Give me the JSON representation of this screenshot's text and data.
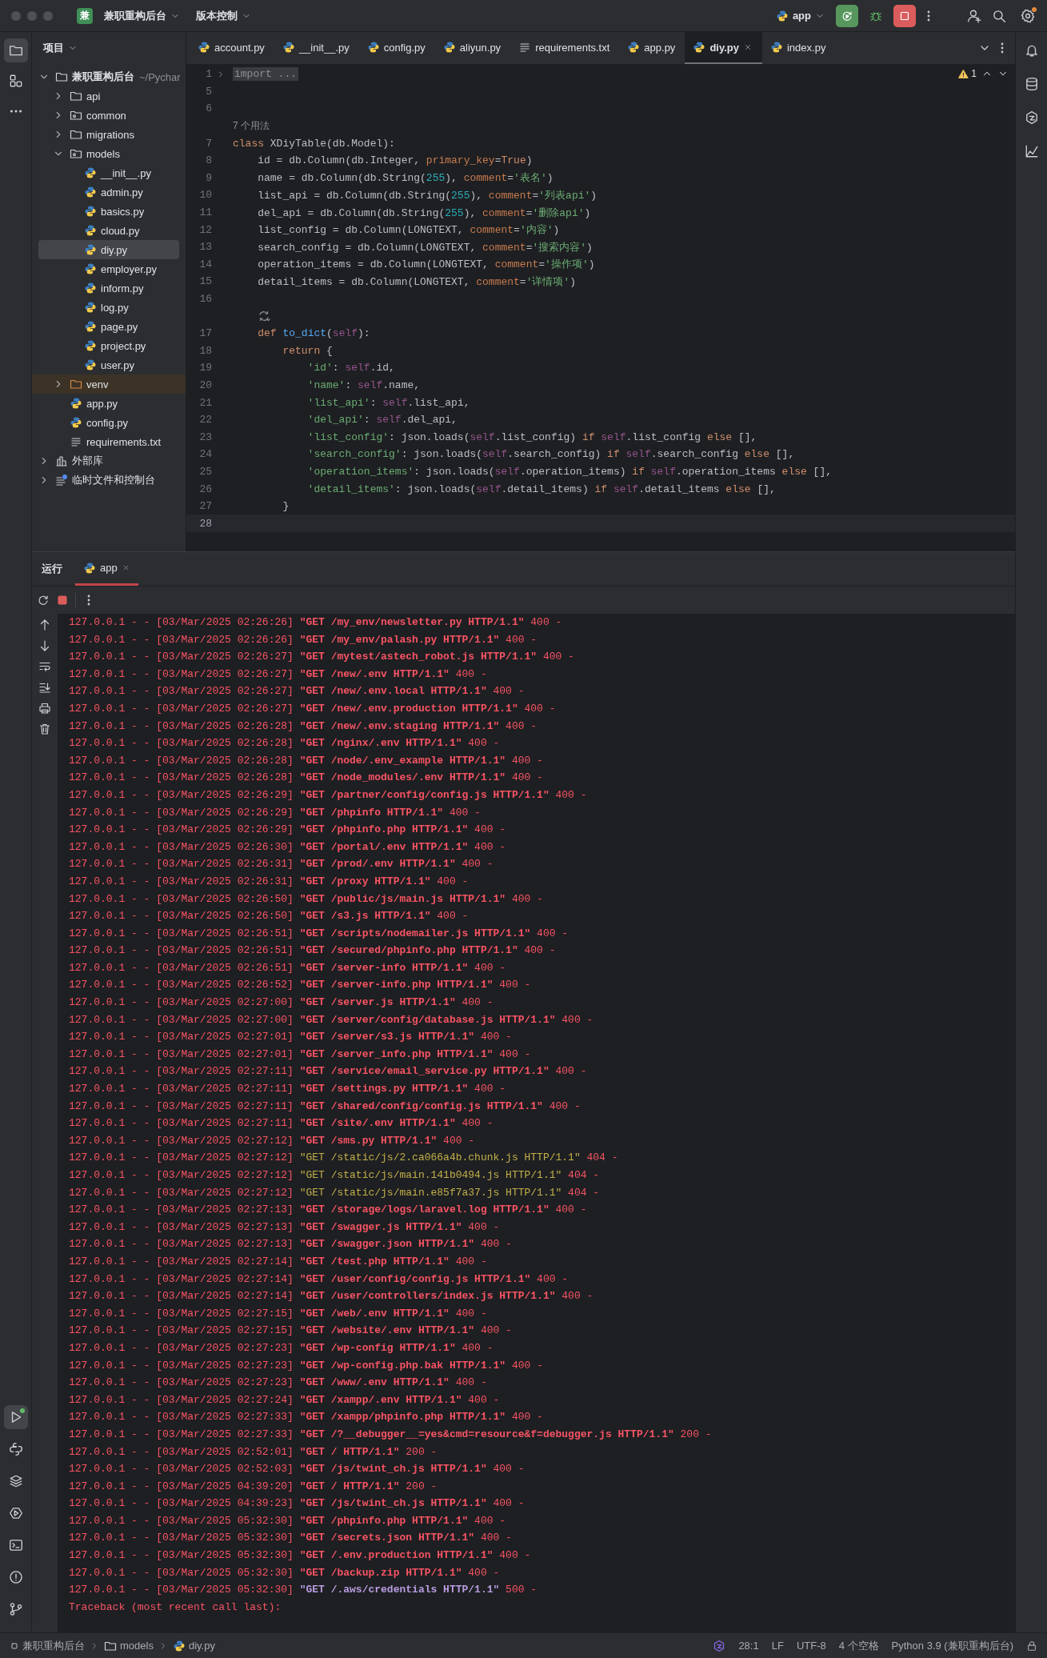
{
  "titlebar": {
    "project_badge": "兼",
    "project": "兼职重构后台",
    "vcs": "版本控制",
    "run_config": "app"
  },
  "project": {
    "title": "项目",
    "tree": [
      {
        "kind": "root",
        "label": "兼职重构后台",
        "path": "~/Pychar",
        "expanded": true,
        "selected": false,
        "children": [
          {
            "kind": "folder",
            "label": "api",
            "expanded": false,
            "selected": false
          },
          {
            "kind": "package",
            "label": "common",
            "expanded": false,
            "selected": false
          },
          {
            "kind": "folder",
            "label": "migrations",
            "expanded": false,
            "selected": false
          },
          {
            "kind": "package",
            "label": "models",
            "expanded": true,
            "selected": false,
            "children": [
              {
                "kind": "python",
                "label": "__init__.py",
                "selected": false
              },
              {
                "kind": "python",
                "label": "admin.py",
                "selected": false
              },
              {
                "kind": "python",
                "label": "basics.py",
                "selected": false
              },
              {
                "kind": "python",
                "label": "cloud.py",
                "selected": false
              },
              {
                "kind": "python",
                "label": "diy.py",
                "selected": true
              },
              {
                "kind": "python",
                "label": "employer.py",
                "selected": false
              },
              {
                "kind": "python",
                "label": "inform.py",
                "selected": false
              },
              {
                "kind": "python",
                "label": "log.py",
                "selected": false
              },
              {
                "kind": "python",
                "label": "page.py",
                "selected": false
              },
              {
                "kind": "python",
                "label": "project.py",
                "selected": false
              },
              {
                "kind": "python",
                "label": "user.py",
                "selected": false
              }
            ]
          },
          {
            "kind": "excluded",
            "label": "venv",
            "expanded": false,
            "selected": false
          },
          {
            "kind": "python",
            "label": "app.py",
            "selected": false
          },
          {
            "kind": "python",
            "label": "config.py",
            "selected": false
          },
          {
            "kind": "text",
            "label": "requirements.txt",
            "selected": false
          }
        ]
      },
      {
        "kind": "library",
        "label": "外部库",
        "expanded": false,
        "selected": false
      },
      {
        "kind": "scratch",
        "label": "临时文件和控制台",
        "expanded": false,
        "selected": false
      }
    ]
  },
  "editor": {
    "tabs": [
      {
        "kind": "python",
        "label": "account.py",
        "selected": false
      },
      {
        "kind": "python",
        "label": "__init__.py",
        "selected": false
      },
      {
        "kind": "python",
        "label": "config.py",
        "selected": false
      },
      {
        "kind": "python",
        "label": "aliyun.py",
        "selected": false
      },
      {
        "kind": "text",
        "label": "requirements.txt",
        "selected": false
      },
      {
        "kind": "python",
        "label": "app.py",
        "selected": false
      },
      {
        "kind": "python",
        "label": "diy.py",
        "selected": true
      },
      {
        "kind": "python",
        "label": "index.py",
        "selected": false
      }
    ],
    "warnings": "1",
    "rows": [
      {
        "kind": "folded",
        "number": "1",
        "tokens": [
          {
            "kind": "fold",
            "text": "import ..."
          }
        ]
      },
      {
        "kind": "code",
        "number": "5"
      },
      {
        "kind": "code",
        "number": "6"
      },
      {
        "kind": "hint",
        "text": "7 个用法"
      },
      {
        "kind": "code",
        "number": "7",
        "tokens": [
          {
            "kind": "k",
            "text": "class "
          },
          {
            "kind": "p",
            "text": "XDiyTable(db.Model):"
          }
        ]
      },
      {
        "kind": "code",
        "number": "8",
        "tokens": [
          {
            "kind": "p",
            "text": "    id = db.Column(db.Integer, "
          },
          {
            "kind": "a",
            "text": "primary_key"
          },
          {
            "kind": "p",
            "text": "="
          },
          {
            "kind": "k",
            "text": "True"
          },
          {
            "kind": "p",
            "text": ")"
          }
        ]
      },
      {
        "kind": "code",
        "number": "9",
        "tokens": [
          {
            "kind": "p",
            "text": "    name = db.Column(db.String("
          },
          {
            "kind": "n",
            "text": "255"
          },
          {
            "kind": "p",
            "text": "), "
          },
          {
            "kind": "a",
            "text": "comment"
          },
          {
            "kind": "p",
            "text": "="
          },
          {
            "kind": "s",
            "text": "'表名'"
          },
          {
            "kind": "p",
            "text": ")"
          }
        ]
      },
      {
        "kind": "code",
        "number": "10",
        "tokens": [
          {
            "kind": "p",
            "text": "    list_api = db.Column(db.String("
          },
          {
            "kind": "n",
            "text": "255"
          },
          {
            "kind": "p",
            "text": "), "
          },
          {
            "kind": "a",
            "text": "comment"
          },
          {
            "kind": "p",
            "text": "="
          },
          {
            "kind": "s",
            "text": "'列表api'"
          },
          {
            "kind": "p",
            "text": ")"
          }
        ]
      },
      {
        "kind": "code",
        "number": "11",
        "tokens": [
          {
            "kind": "p",
            "text": "    del_api = db.Column(db.String("
          },
          {
            "kind": "n",
            "text": "255"
          },
          {
            "kind": "p",
            "text": "), "
          },
          {
            "kind": "a",
            "text": "comment"
          },
          {
            "kind": "p",
            "text": "="
          },
          {
            "kind": "s",
            "text": "'删除api'"
          },
          {
            "kind": "p",
            "text": ")"
          }
        ]
      },
      {
        "kind": "code",
        "number": "12",
        "tokens": [
          {
            "kind": "p",
            "text": "    list_config = db.Column(LONGTEXT, "
          },
          {
            "kind": "a",
            "text": "comment"
          },
          {
            "kind": "p",
            "text": "="
          },
          {
            "kind": "s",
            "text": "'内容'"
          },
          {
            "kind": "p",
            "text": ")"
          }
        ]
      },
      {
        "kind": "code",
        "number": "13",
        "tokens": [
          {
            "kind": "p",
            "text": "    search_config = db.Column(LONGTEXT, "
          },
          {
            "kind": "a",
            "text": "comment"
          },
          {
            "kind": "p",
            "text": "="
          },
          {
            "kind": "s",
            "text": "'搜索内容'"
          },
          {
            "kind": "p",
            "text": ")"
          }
        ]
      },
      {
        "kind": "code",
        "number": "14",
        "tokens": [
          {
            "kind": "p",
            "text": "    operation_items = db.Column(LONGTEXT, "
          },
          {
            "kind": "a",
            "text": "comment"
          },
          {
            "kind": "p",
            "text": "="
          },
          {
            "kind": "s",
            "text": "'操作项'"
          },
          {
            "kind": "p",
            "text": ")"
          }
        ]
      },
      {
        "kind": "code",
        "number": "15",
        "tokens": [
          {
            "kind": "p",
            "text": "    detail_items = db.Column(LONGTEXT, "
          },
          {
            "kind": "a",
            "text": "comment"
          },
          {
            "kind": "p",
            "text": "="
          },
          {
            "kind": "s",
            "text": "'详情项'"
          },
          {
            "kind": "p",
            "text": ")"
          }
        ]
      },
      {
        "kind": "code",
        "number": "16"
      },
      {
        "kind": "marker"
      },
      {
        "kind": "code",
        "number": "17",
        "tokens": [
          {
            "kind": "k",
            "text": "    def "
          },
          {
            "kind": "f",
            "text": "to_dict"
          },
          {
            "kind": "p",
            "text": "("
          },
          {
            "kind": "self",
            "text": "self"
          },
          {
            "kind": "p",
            "text": "):"
          }
        ]
      },
      {
        "kind": "code",
        "number": "18",
        "tokens": [
          {
            "kind": "k",
            "text": "        return"
          },
          {
            "kind": "p",
            "text": " {"
          }
        ]
      },
      {
        "kind": "code",
        "number": "19",
        "tokens": [
          {
            "kind": "s",
            "text": "            'id'"
          },
          {
            "kind": "p",
            "text": ": "
          },
          {
            "kind": "self",
            "text": "self"
          },
          {
            "kind": "p",
            "text": ".id,"
          }
        ]
      },
      {
        "kind": "code",
        "number": "20",
        "tokens": [
          {
            "kind": "s",
            "text": "            'name'"
          },
          {
            "kind": "p",
            "text": ": "
          },
          {
            "kind": "self",
            "text": "self"
          },
          {
            "kind": "p",
            "text": ".name,"
          }
        ]
      },
      {
        "kind": "code",
        "number": "21",
        "tokens": [
          {
            "kind": "s",
            "text": "            'list_api'"
          },
          {
            "kind": "p",
            "text": ": "
          },
          {
            "kind": "self",
            "text": "self"
          },
          {
            "kind": "p",
            "text": ".list_api,"
          }
        ]
      },
      {
        "kind": "code",
        "number": "22",
        "tokens": [
          {
            "kind": "s",
            "text": "            'del_api'"
          },
          {
            "kind": "p",
            "text": ": "
          },
          {
            "kind": "self",
            "text": "self"
          },
          {
            "kind": "p",
            "text": ".del_api,"
          }
        ]
      },
      {
        "kind": "code",
        "number": "23",
        "tokens": [
          {
            "kind": "s",
            "text": "            'list_config'"
          },
          {
            "kind": "p",
            "text": ": json.loads("
          },
          {
            "kind": "self",
            "text": "self"
          },
          {
            "kind": "p",
            "text": ".list_config) "
          },
          {
            "kind": "k",
            "text": "if "
          },
          {
            "kind": "self",
            "text": "self"
          },
          {
            "kind": "p",
            "text": ".list_config "
          },
          {
            "kind": "k",
            "text": "else"
          },
          {
            "kind": "p",
            "text": " [],"
          }
        ]
      },
      {
        "kind": "code",
        "number": "24",
        "tokens": [
          {
            "kind": "s",
            "text": "            'search_config'"
          },
          {
            "kind": "p",
            "text": ": json.loads("
          },
          {
            "kind": "self",
            "text": "self"
          },
          {
            "kind": "p",
            "text": ".search_config) "
          },
          {
            "kind": "k",
            "text": "if "
          },
          {
            "kind": "self",
            "text": "self"
          },
          {
            "kind": "p",
            "text": ".search_config "
          },
          {
            "kind": "k",
            "text": "else"
          },
          {
            "kind": "p",
            "text": " [],"
          }
        ]
      },
      {
        "kind": "code",
        "number": "25",
        "tokens": [
          {
            "kind": "s",
            "text": "            'operation_items'"
          },
          {
            "kind": "p",
            "text": ": json.loads("
          },
          {
            "kind": "self",
            "text": "self"
          },
          {
            "kind": "p",
            "text": ".operation_items) "
          },
          {
            "kind": "k",
            "text": "if "
          },
          {
            "kind": "self",
            "text": "self"
          },
          {
            "kind": "p",
            "text": ".operation_items "
          },
          {
            "kind": "k",
            "text": "else"
          },
          {
            "kind": "p",
            "text": " [],"
          }
        ]
      },
      {
        "kind": "code",
        "number": "26",
        "tokens": [
          {
            "kind": "s",
            "text": "            'detail_items'"
          },
          {
            "kind": "p",
            "text": ": json.loads("
          },
          {
            "kind": "self",
            "text": "self"
          },
          {
            "kind": "p",
            "text": ".detail_items) "
          },
          {
            "kind": "k",
            "text": "if "
          },
          {
            "kind": "self",
            "text": "self"
          },
          {
            "kind": "p",
            "text": ".detail_items "
          },
          {
            "kind": "k",
            "text": "else"
          },
          {
            "kind": "p",
            "text": " [],"
          }
        ]
      },
      {
        "kind": "code",
        "number": "27",
        "tokens": [
          {
            "kind": "p",
            "text": "        }"
          }
        ]
      },
      {
        "kind": "current",
        "number": "28"
      }
    ]
  },
  "run": {
    "title": "运行",
    "tabs": [
      {
        "label": "app",
        "selected": true
      }
    ],
    "log": [
      {
        "kind": "error",
        "text": "127.0.0.1 - - [03/Mar/2025 02:26:26] ",
        "request": "\"GET /my_env/newsletter.py HTTP/1.1\"",
        "tail": " 400 -"
      },
      {
        "kind": "error",
        "text": "127.0.0.1 - - [03/Mar/2025 02:26:26] ",
        "request": "\"GET /my_env/palash.py HTTP/1.1\"",
        "tail": " 400 -"
      },
      {
        "kind": "error",
        "text": "127.0.0.1 - - [03/Mar/2025 02:26:27] ",
        "request": "\"GET /mytest/astech_robot.js HTTP/1.1\"",
        "tail": " 400 -"
      },
      {
        "kind": "error",
        "text": "127.0.0.1 - - [03/Mar/2025 02:26:27] ",
        "request": "\"GET /new/.env HTTP/1.1\"",
        "tail": " 400 -"
      },
      {
        "kind": "error",
        "text": "127.0.0.1 - - [03/Mar/2025 02:26:27] ",
        "request": "\"GET /new/.env.local HTTP/1.1\"",
        "tail": " 400 -"
      },
      {
        "kind": "error",
        "text": "127.0.0.1 - - [03/Mar/2025 02:26:27] ",
        "request": "\"GET /new/.env.production HTTP/1.1\"",
        "tail": " 400 -"
      },
      {
        "kind": "error",
        "text": "127.0.0.1 - - [03/Mar/2025 02:26:28] ",
        "request": "\"GET /new/.env.staging HTTP/1.1\"",
        "tail": " 400 -"
      },
      {
        "kind": "error",
        "text": "127.0.0.1 - - [03/Mar/2025 02:26:28] ",
        "request": "\"GET /nginx/.env HTTP/1.1\"",
        "tail": " 400 -"
      },
      {
        "kind": "error",
        "text": "127.0.0.1 - - [03/Mar/2025 02:26:28] ",
        "request": "\"GET /node/.env_example HTTP/1.1\"",
        "tail": " 400 -"
      },
      {
        "kind": "error",
        "text": "127.0.0.1 - - [03/Mar/2025 02:26:28] ",
        "request": "\"GET /node_modules/.env HTTP/1.1\"",
        "tail": " 400 -"
      },
      {
        "kind": "error",
        "text": "127.0.0.1 - - [03/Mar/2025 02:26:29] ",
        "request": "\"GET /partner/config/config.js HTTP/1.1\"",
        "tail": " 400 -"
      },
      {
        "kind": "error",
        "text": "127.0.0.1 - - [03/Mar/2025 02:26:29] ",
        "request": "\"GET /phpinfo HTTP/1.1\"",
        "tail": " 400 -"
      },
      {
        "kind": "error",
        "text": "127.0.0.1 - - [03/Mar/2025 02:26:29] ",
        "request": "\"GET /phpinfo.php HTTP/1.1\"",
        "tail": " 400 -"
      },
      {
        "kind": "error",
        "text": "127.0.0.1 - - [03/Mar/2025 02:26:30] ",
        "request": "\"GET /portal/.env HTTP/1.1\"",
        "tail": " 400 -"
      },
      {
        "kind": "error",
        "text": "127.0.0.1 - - [03/Mar/2025 02:26:31] ",
        "request": "\"GET /prod/.env HTTP/1.1\"",
        "tail": " 400 -"
      },
      {
        "kind": "error",
        "text": "127.0.0.1 - - [03/Mar/2025 02:26:31] ",
        "request": "\"GET /proxy HTTP/1.1\"",
        "tail": " 400 -"
      },
      {
        "kind": "error",
        "text": "127.0.0.1 - - [03/Mar/2025 02:26:50] ",
        "request": "\"GET /public/js/main.js HTTP/1.1\"",
        "tail": " 400 -"
      },
      {
        "kind": "error",
        "text": "127.0.0.1 - - [03/Mar/2025 02:26:50] ",
        "request": "\"GET /s3.js HTTP/1.1\"",
        "tail": " 400 -"
      },
      {
        "kind": "error",
        "text": "127.0.0.1 - - [03/Mar/2025 02:26:51] ",
        "request": "\"GET /scripts/nodemailer.js HTTP/1.1\"",
        "tail": " 400 -"
      },
      {
        "kind": "error",
        "text": "127.0.0.1 - - [03/Mar/2025 02:26:51] ",
        "request": "\"GET /secured/phpinfo.php HTTP/1.1\"",
        "tail": " 400 -"
      },
      {
        "kind": "error",
        "text": "127.0.0.1 - - [03/Mar/2025 02:26:51] ",
        "request": "\"GET /server-info HTTP/1.1\"",
        "tail": " 400 -"
      },
      {
        "kind": "error",
        "text": "127.0.0.1 - - [03/Mar/2025 02:26:52] ",
        "request": "\"GET /server-info.php HTTP/1.1\"",
        "tail": " 400 -"
      },
      {
        "kind": "error",
        "text": "127.0.0.1 - - [03/Mar/2025 02:27:00] ",
        "request": "\"GET /server.js HTTP/1.1\"",
        "tail": " 400 -"
      },
      {
        "kind": "error",
        "text": "127.0.0.1 - - [03/Mar/2025 02:27:00] ",
        "request": "\"GET /server/config/database.js HTTP/1.1\"",
        "tail": " 400 -"
      },
      {
        "kind": "error",
        "text": "127.0.0.1 - - [03/Mar/2025 02:27:01] ",
        "request": "\"GET /server/s3.js HTTP/1.1\"",
        "tail": " 400 -"
      },
      {
        "kind": "error",
        "text": "127.0.0.1 - - [03/Mar/2025 02:27:01] ",
        "request": "\"GET /server_info.php HTTP/1.1\"",
        "tail": " 400 -"
      },
      {
        "kind": "error",
        "text": "127.0.0.1 - - [03/Mar/2025 02:27:11] ",
        "request": "\"GET /service/email_service.py HTTP/1.1\"",
        "tail": " 400 -"
      },
      {
        "kind": "error",
        "text": "127.0.0.1 - - [03/Mar/2025 02:27:11] ",
        "request": "\"GET /settings.py HTTP/1.1\"",
        "tail": " 400 -"
      },
      {
        "kind": "error",
        "text": "127.0.0.1 - - [03/Mar/2025 02:27:11] ",
        "request": "\"GET /shared/config/config.js HTTP/1.1\"",
        "tail": " 400 -"
      },
      {
        "kind": "error",
        "text": "127.0.0.1 - - [03/Mar/2025 02:27:11] ",
        "request": "\"GET /site/.env HTTP/1.1\"",
        "tail": " 400 -"
      },
      {
        "kind": "error",
        "text": "127.0.0.1 - - [03/Mar/2025 02:27:12] ",
        "request": "\"GET /sms.py HTTP/1.1\"",
        "tail": " 400 -"
      },
      {
        "kind": "warning",
        "text": "127.0.0.1 - - [03/Mar/2025 02:27:12] ",
        "request": "\"GET /static/js/2.ca066a4b.chunk.js HTTP/1.1\"",
        "tail": " 404 -"
      },
      {
        "kind": "warning",
        "text": "127.0.0.1 - - [03/Mar/2025 02:27:12] ",
        "request": "\"GET /static/js/main.141b0494.js HTTP/1.1\"",
        "tail": " 404 -"
      },
      {
        "kind": "warning",
        "text": "127.0.0.1 - - [03/Mar/2025 02:27:12] ",
        "request": "\"GET /static/js/main.e85f7a37.js HTTP/1.1\"",
        "tail": " 404 -"
      },
      {
        "kind": "error",
        "text": "127.0.0.1 - - [03/Mar/2025 02:27:13] ",
        "request": "\"GET /storage/logs/laravel.log HTTP/1.1\"",
        "tail": " 400 -"
      },
      {
        "kind": "error",
        "text": "127.0.0.1 - - [03/Mar/2025 02:27:13] ",
        "request": "\"GET /swagger.js HTTP/1.1\"",
        "tail": " 400 -"
      },
      {
        "kind": "error",
        "text": "127.0.0.1 - - [03/Mar/2025 02:27:13] ",
        "request": "\"GET /swagger.json HTTP/1.1\"",
        "tail": " 400 -"
      },
      {
        "kind": "error",
        "text": "127.0.0.1 - - [03/Mar/2025 02:27:14] ",
        "request": "\"GET /test.php HTTP/1.1\"",
        "tail": " 400 -"
      },
      {
        "kind": "error",
        "text": "127.0.0.1 - - [03/Mar/2025 02:27:14] ",
        "request": "\"GET /user/config/config.js HTTP/1.1\"",
        "tail": " 400 -"
      },
      {
        "kind": "error",
        "text": "127.0.0.1 - - [03/Mar/2025 02:27:14] ",
        "request": "\"GET /user/controllers/index.js HTTP/1.1\"",
        "tail": " 400 -"
      },
      {
        "kind": "error",
        "text": "127.0.0.1 - - [03/Mar/2025 02:27:15] ",
        "request": "\"GET /web/.env HTTP/1.1\"",
        "tail": " 400 -"
      },
      {
        "kind": "error",
        "text": "127.0.0.1 - - [03/Mar/2025 02:27:15] ",
        "request": "\"GET /website/.env HTTP/1.1\"",
        "tail": " 400 -"
      },
      {
        "kind": "error",
        "text": "127.0.0.1 - - [03/Mar/2025 02:27:23] ",
        "request": "\"GET /wp-config HTTP/1.1\"",
        "tail": " 400 -"
      },
      {
        "kind": "error",
        "text": "127.0.0.1 - - [03/Mar/2025 02:27:23] ",
        "request": "\"GET /wp-config.php.bak HTTP/1.1\"",
        "tail": " 400 -"
      },
      {
        "kind": "error",
        "text": "127.0.0.1 - - [03/Mar/2025 02:27:23] ",
        "request": "\"GET /www/.env HTTP/1.1\"",
        "tail": " 400 -"
      },
      {
        "kind": "error",
        "text": "127.0.0.1 - - [03/Mar/2025 02:27:24] ",
        "request": "\"GET /xampp/.env HTTP/1.1\"",
        "tail": " 400 -"
      },
      {
        "kind": "error",
        "text": "127.0.0.1 - - [03/Mar/2025 02:27:33] ",
        "request": "\"GET /xampp/phpinfo.php HTTP/1.1\"",
        "tail": " 400 -"
      },
      {
        "kind": "error",
        "text": "127.0.0.1 - - [03/Mar/2025 02:27:33] ",
        "request": "\"GET /?__debugger__=yes&cmd=resource&f=debugger.js HTTP/1.1\"",
        "tail": " 200 -"
      },
      {
        "kind": "error",
        "text": "127.0.0.1 - - [03/Mar/2025 02:52:01] ",
        "request": "\"GET / HTTP/1.1\"",
        "tail": " 200 -"
      },
      {
        "kind": "error",
        "text": "127.0.0.1 - - [03/Mar/2025 02:52:03] ",
        "request": "\"GET /js/twint_ch.js HTTP/1.1\"",
        "tail": " 400 -"
      },
      {
        "kind": "error",
        "text": "127.0.0.1 - - [03/Mar/2025 04:39:20] ",
        "request": "\"GET / HTTP/1.1\"",
        "tail": " 200 -"
      },
      {
        "kind": "error",
        "text": "127.0.0.1 - - [03/Mar/2025 04:39:23] ",
        "request": "\"GET /js/twint_ch.js HTTP/1.1\"",
        "tail": " 400 -"
      },
      {
        "kind": "error",
        "text": "127.0.0.1 - - [03/Mar/2025 05:32:30] ",
        "request": "\"GET /phpinfo.php HTTP/1.1\"",
        "tail": " 400 -"
      },
      {
        "kind": "error",
        "text": "127.0.0.1 - - [03/Mar/2025 05:32:30] ",
        "request": "\"GET /secrets.json HTTP/1.1\"",
        "tail": " 400 -"
      },
      {
        "kind": "error",
        "text": "127.0.0.1 - - [03/Mar/2025 05:32:30] ",
        "request": "\"GET /.env.production HTTP/1.1\"",
        "tail": " 400 -"
      },
      {
        "kind": "error",
        "text": "127.0.0.1 - - [03/Mar/2025 05:32:30] ",
        "request": "\"GET /backup.zip HTTP/1.1\"",
        "tail": " 400 -"
      },
      {
        "kind": "server_error",
        "text": "127.0.0.1 - - [03/Mar/2025 05:32:30] ",
        "request": "\"GET /.aws/credentials HTTP/1.1\"",
        "tail": " 500 -"
      },
      {
        "kind": "traceback",
        "text": "Traceback (most recent call last):"
      }
    ]
  },
  "status_bar": {
    "breadcrumbs": [
      {
        "kind": "project",
        "label": "兼职重构后台"
      },
      {
        "kind": "folder",
        "label": "models"
      },
      {
        "kind": "python",
        "label": "diy.py"
      }
    ],
    "items": [
      "28:1",
      "LF",
      "UTF-8",
      "4 个空格",
      "Python 3.9 (兼职重构后台)"
    ]
  }
}
